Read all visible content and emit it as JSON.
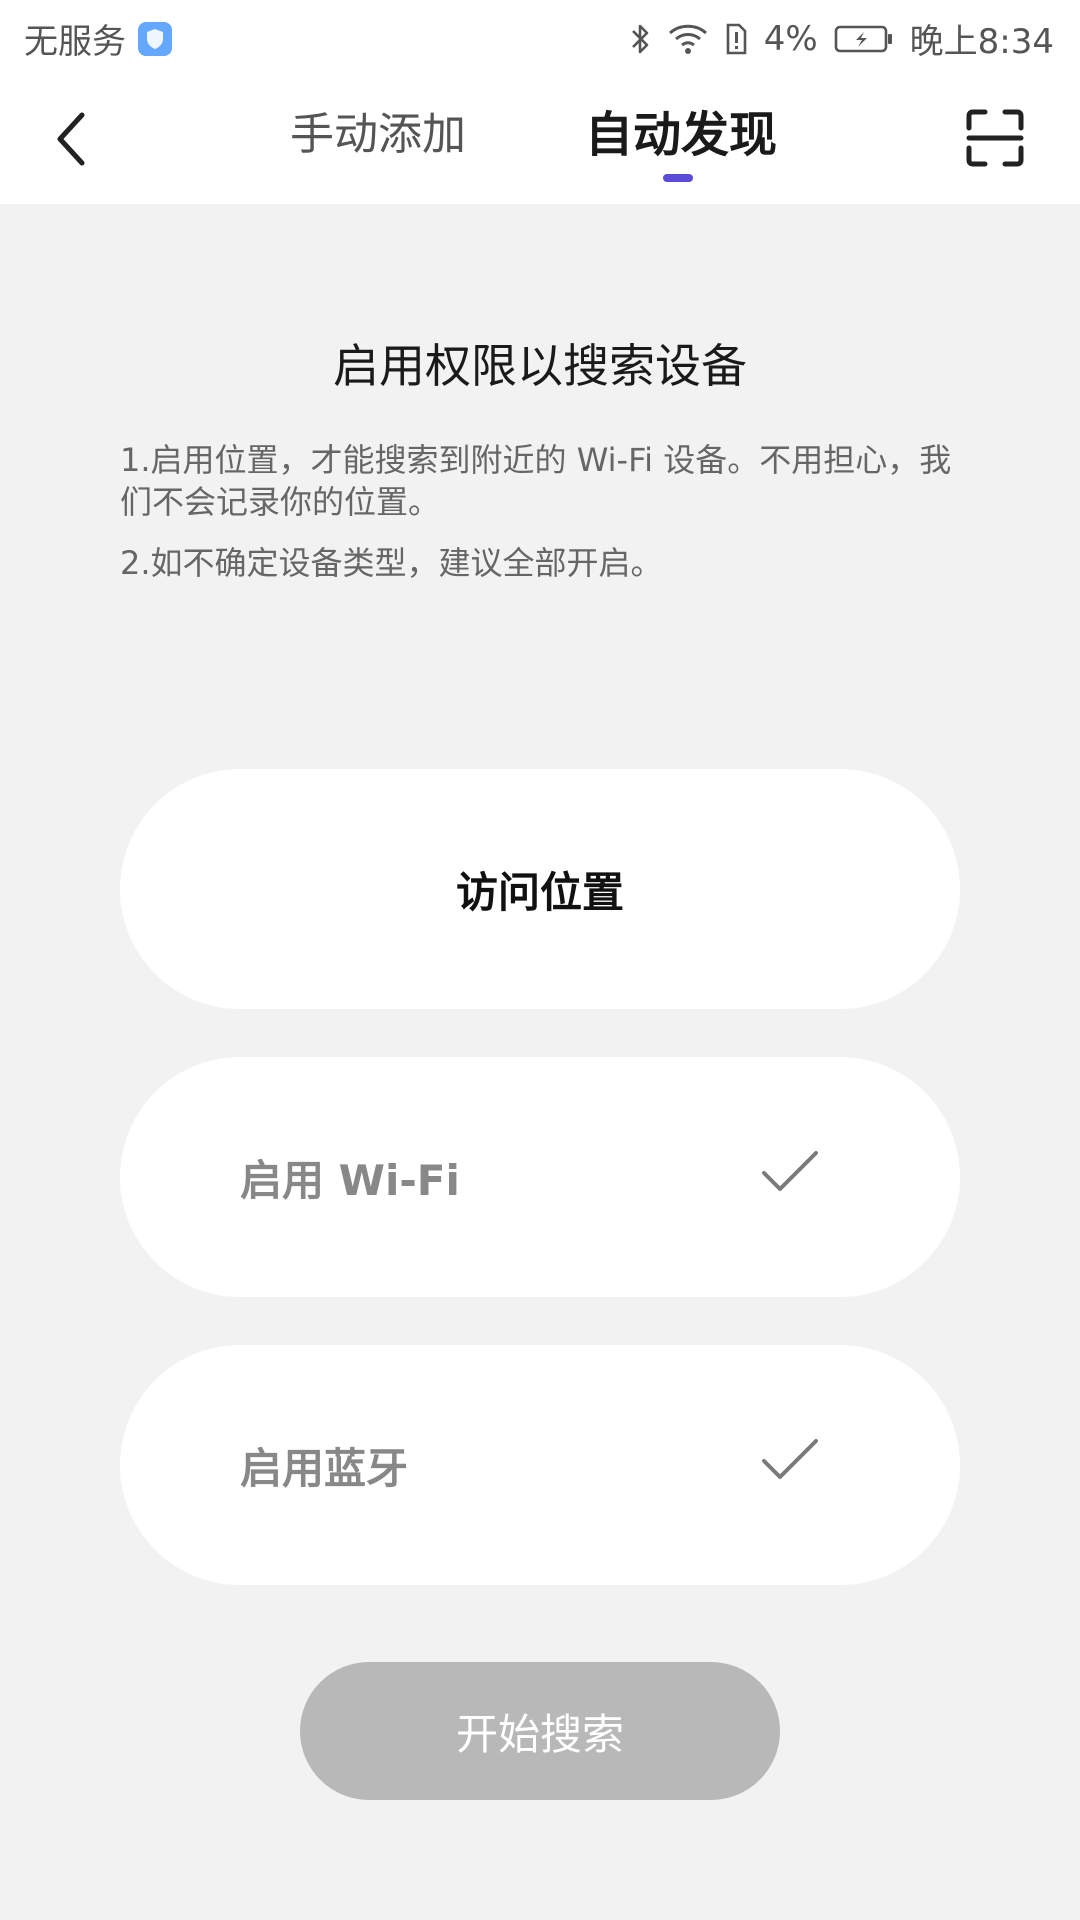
{
  "status_bar": {
    "carrier": "无服务",
    "battery": "4%",
    "time": "晚上8:34",
    "icons": [
      "shield-icon",
      "bluetooth-icon",
      "wifi-icon",
      "sim-alert-icon",
      "battery-icon"
    ]
  },
  "header": {
    "tabs": [
      {
        "label": "手动添加"
      },
      {
        "label": "自动发现"
      }
    ],
    "accent_color": "#5a4bd9"
  },
  "content": {
    "title": "启用权限以搜索设备",
    "desc1": "1.启用位置，才能搜索到附近的 Wi-Fi 设备。不用担心，我们不会记录你的位置。",
    "desc2": "2.如不确定设备类型，建议全部开启。"
  },
  "permissions": {
    "location_label": "访问位置",
    "wifi_label": "启用 Wi-Fi",
    "bluetooth_label": "启用蓝牙"
  },
  "start_button": {
    "label": "开始搜索"
  }
}
